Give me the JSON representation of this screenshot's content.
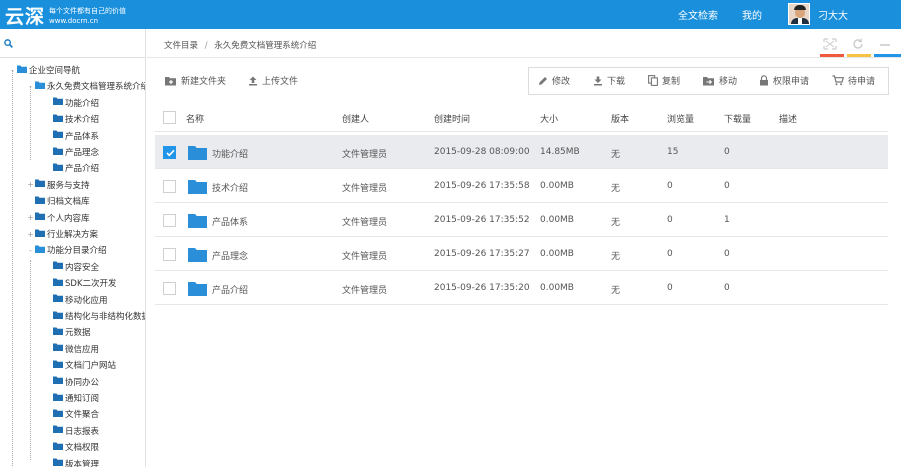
{
  "header": {
    "logo": "云深",
    "slogan": "每个文件都有自己的价值",
    "url": "www.docrn.cn",
    "nav_search": "全文检索",
    "nav_mine": "我的",
    "user_name": "刁大大"
  },
  "sidebar": {
    "tree": [
      {
        "label": "企业空间导航",
        "level": 0,
        "expander": "-",
        "open": true
      },
      {
        "label": "永久免费文档管理系统介绍",
        "level": 1,
        "expander": "-",
        "open": true
      },
      {
        "label": "功能介绍",
        "level": 2,
        "expander": ""
      },
      {
        "label": "技术介绍",
        "level": 2,
        "expander": ""
      },
      {
        "label": "产品体系",
        "level": 2,
        "expander": ""
      },
      {
        "label": "产品理念",
        "level": 2,
        "expander": ""
      },
      {
        "label": "产品介绍",
        "level": 2,
        "expander": ""
      },
      {
        "label": "服务与支持",
        "level": 1,
        "expander": "+"
      },
      {
        "label": "归档文档库",
        "level": 1,
        "expander": ""
      },
      {
        "label": "个人内容库",
        "level": 1,
        "expander": "+"
      },
      {
        "label": "行业解决方案",
        "level": 1,
        "expander": "+"
      },
      {
        "label": "功能分目录介绍",
        "level": 1,
        "expander": "-",
        "open": true
      },
      {
        "label": "内容安全",
        "level": 2,
        "expander": ""
      },
      {
        "label": "SDK二次开发",
        "level": 2,
        "expander": ""
      },
      {
        "label": "移动化应用",
        "level": 2,
        "expander": ""
      },
      {
        "label": "结构化与非结构化数据",
        "level": 2,
        "expander": ""
      },
      {
        "label": "元数据",
        "level": 2,
        "expander": ""
      },
      {
        "label": "微信应用",
        "level": 2,
        "expander": ""
      },
      {
        "label": "文档门户网站",
        "level": 2,
        "expander": ""
      },
      {
        "label": "协同办公",
        "level": 2,
        "expander": ""
      },
      {
        "label": "通知订阅",
        "level": 2,
        "expander": ""
      },
      {
        "label": "文件聚合",
        "level": 2,
        "expander": ""
      },
      {
        "label": "日志报表",
        "level": 2,
        "expander": ""
      },
      {
        "label": "文档权限",
        "level": 2,
        "expander": ""
      },
      {
        "label": "版本管理",
        "level": 2,
        "expander": ""
      }
    ]
  },
  "breadcrumb": {
    "root": "文件目录",
    "separator": "/",
    "current": "永久免费文档管理系统介绍"
  },
  "toolbar": {
    "new_folder": "新建文件夹",
    "upload": "上传文件",
    "edit": "修改",
    "download": "下载",
    "copy": "复制",
    "move": "移动",
    "permission": "权限申请",
    "pending": "待申请"
  },
  "table": {
    "headers": {
      "name": "名称",
      "creator": "创建人",
      "created": "创建时间",
      "size": "大小",
      "version": "版本",
      "views": "浏览量",
      "downloads": "下载量",
      "desc": "描述"
    },
    "rows": [
      {
        "name": "功能介绍",
        "creator": "文件管理员",
        "created": "2015-09-28 08:09:00",
        "size": "14.85MB",
        "version": "无",
        "views": "15",
        "downloads": "0",
        "selected": true
      },
      {
        "name": "技术介绍",
        "creator": "文件管理员",
        "created": "2015-09-26 17:35:58",
        "size": "0.00MB",
        "version": "无",
        "views": "0",
        "downloads": "0",
        "selected": false
      },
      {
        "name": "产品体系",
        "creator": "文件管理员",
        "created": "2015-09-26 17:35:52",
        "size": "0.00MB",
        "version": "无",
        "views": "0",
        "downloads": "1",
        "selected": false
      },
      {
        "name": "产品理念",
        "creator": "文件管理员",
        "created": "2015-09-26 17:35:27",
        "size": "0.00MB",
        "version": "无",
        "views": "0",
        "downloads": "0",
        "selected": false
      },
      {
        "name": "产品介绍",
        "creator": "文件管理员",
        "created": "2015-09-26 17:35:20",
        "size": "0.00MB",
        "version": "无",
        "views": "0",
        "downloads": "0",
        "selected": false
      }
    ]
  },
  "colors": {
    "header_bg": "#1a90dd",
    "folder": "#2a8fd8",
    "checkbox_checked": "#2196e8",
    "accent_red": "#f0593e",
    "accent_yellow": "#f6c344",
    "accent_blue": "#2196e8"
  }
}
